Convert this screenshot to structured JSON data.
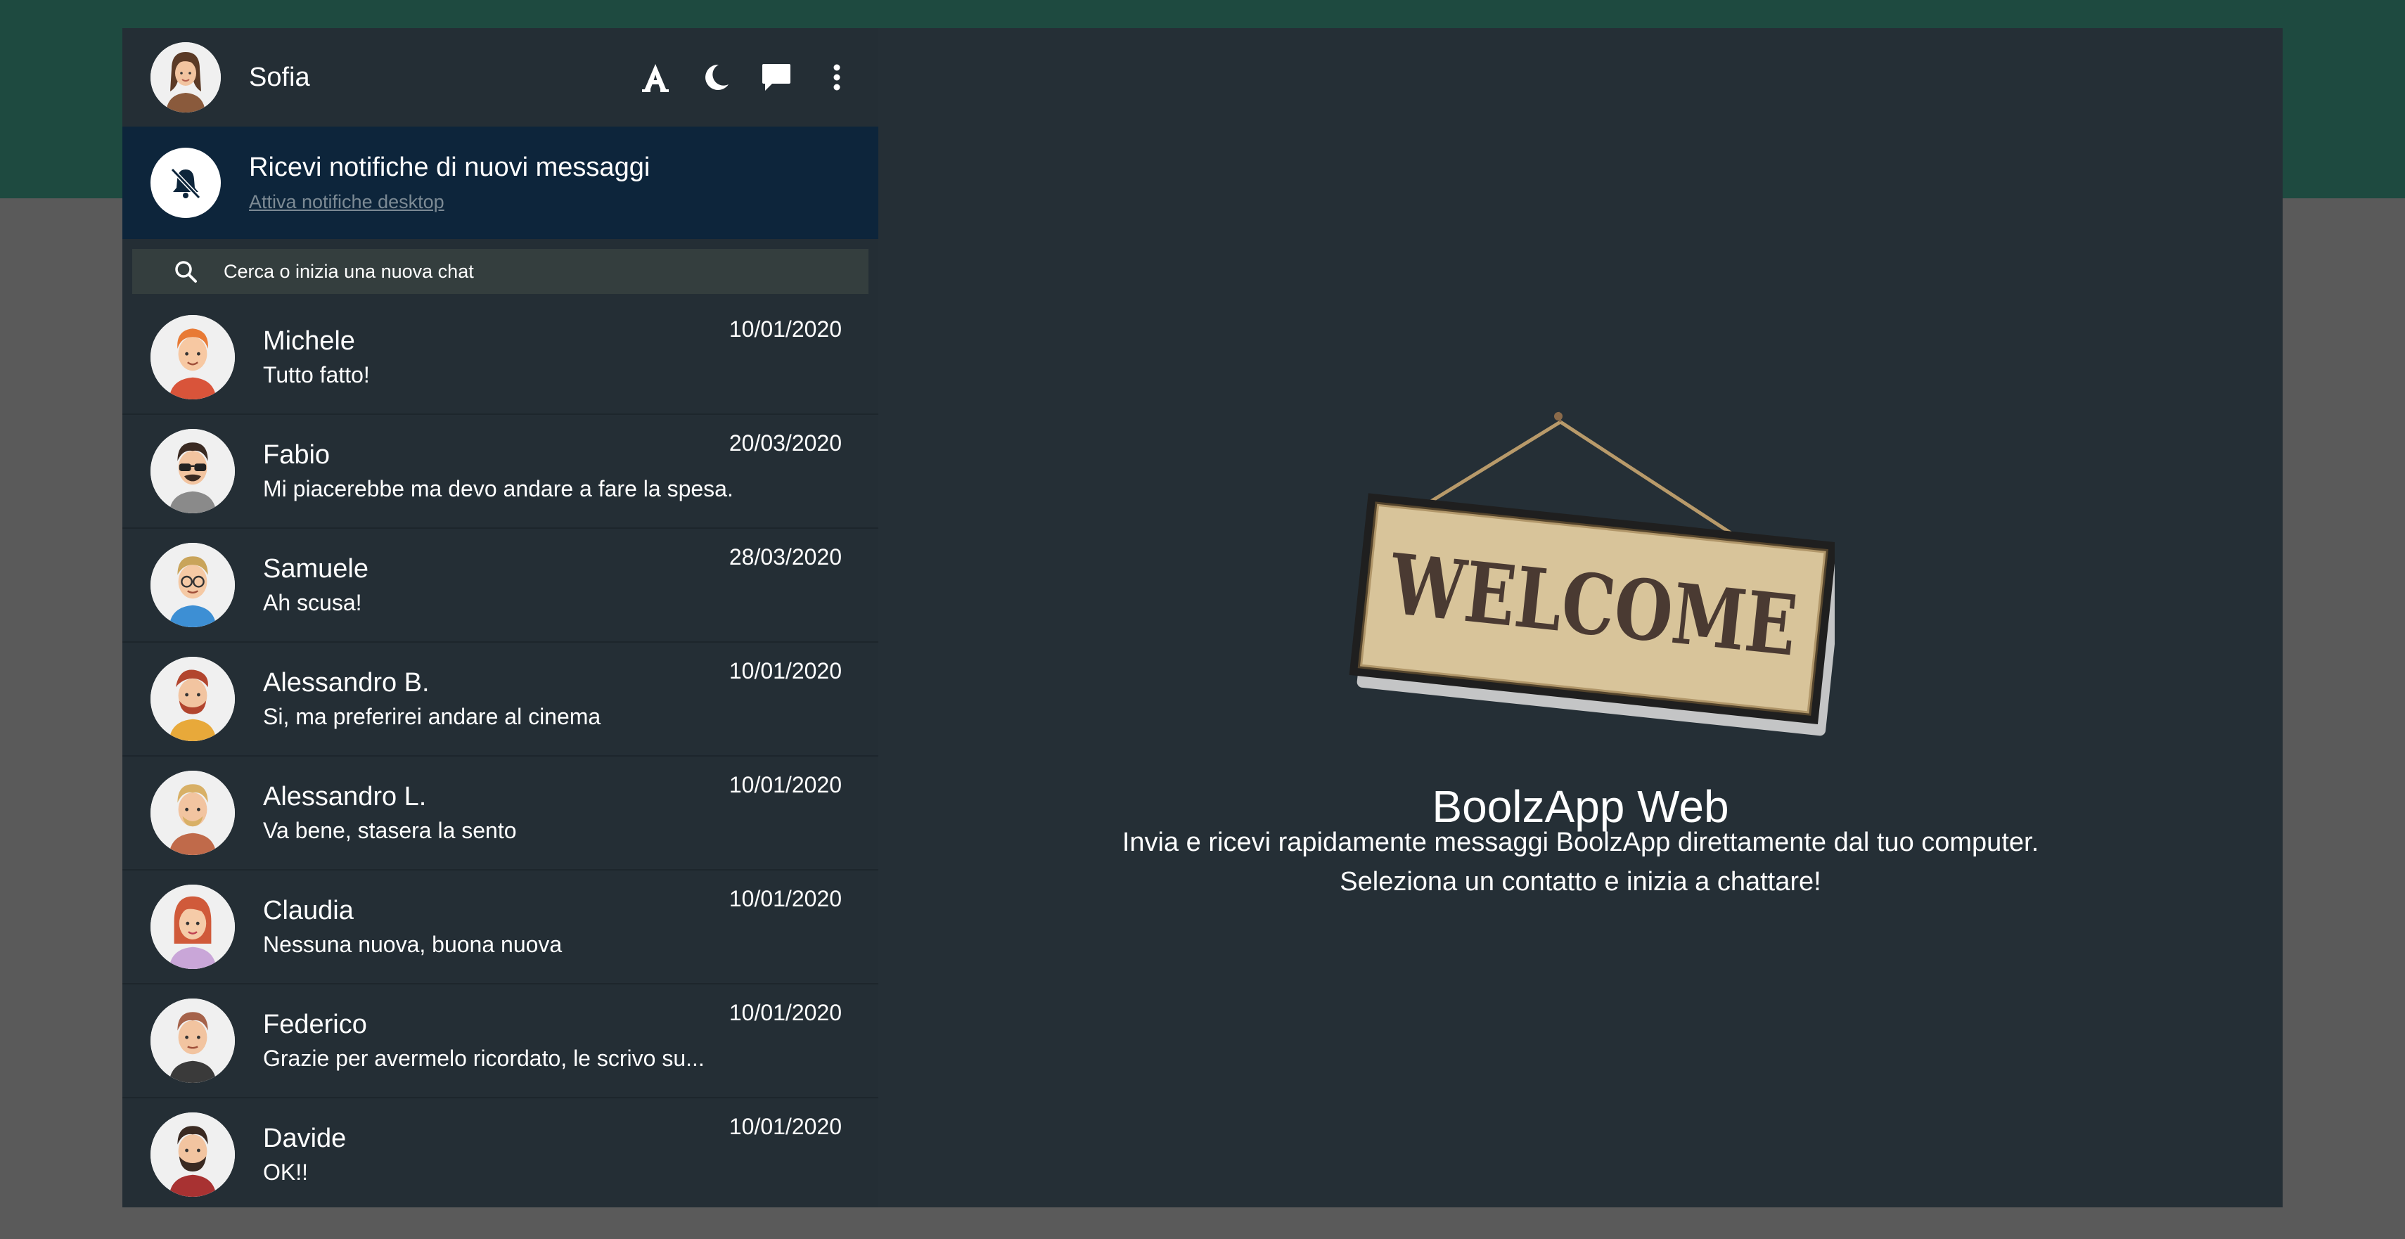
{
  "user": {
    "name": "Sofia"
  },
  "header_icons": [
    "font-icon",
    "moon-icon",
    "chat-icon",
    "more-vertical-icon"
  ],
  "notification": {
    "title": "Ricevi notifiche di nuovi messaggi",
    "link": "Attiva notifiche desktop"
  },
  "search": {
    "placeholder": "Cerca o inizia una nuova chat"
  },
  "contacts": [
    {
      "name": "Michele",
      "message": "Tutto fatto!",
      "date": "10/01/2020"
    },
    {
      "name": "Fabio",
      "message": "Mi piacerebbe ma devo andare a fare la spesa.",
      "date": "20/03/2020"
    },
    {
      "name": "Samuele",
      "message": "Ah scusa!",
      "date": "28/03/2020"
    },
    {
      "name": "Alessandro B.",
      "message": "Si, ma preferirei andare al cinema",
      "date": "10/01/2020"
    },
    {
      "name": "Alessandro L.",
      "message": "Va bene, stasera la sento",
      "date": "10/01/2020"
    },
    {
      "name": "Claudia",
      "message": "Nessuna nuova, buona nuova",
      "date": "10/01/2020"
    },
    {
      "name": "Federico",
      "message": "Grazie per avermelo ricordato, le scrivo su...",
      "date": "10/01/2020"
    },
    {
      "name": "Davide",
      "message": "OK!!",
      "date": "10/01/2020"
    }
  ],
  "main": {
    "sign_text": "WELCOME",
    "title": "BoolzApp Web",
    "subtitle_line1": "Invia e ricevi rapidamente messaggi BoolzApp direttamente dal tuo computer.",
    "subtitle_line2": "Seleziona un contatto e inizia a chattare!"
  },
  "colors": {
    "top_band": "#1e4a40",
    "app_background": "#252f36",
    "notification_background": "#0d253b",
    "search_background": "#343e3e"
  }
}
